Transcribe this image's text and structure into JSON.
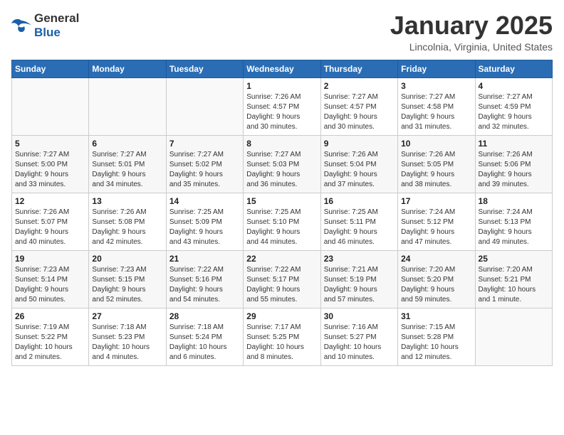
{
  "logo": {
    "general": "General",
    "blue": "Blue"
  },
  "title": "January 2025",
  "subtitle": "Lincolnia, Virginia, United States",
  "days_header": [
    "Sunday",
    "Monday",
    "Tuesday",
    "Wednesday",
    "Thursday",
    "Friday",
    "Saturday"
  ],
  "weeks": [
    [
      {
        "day": "",
        "info": ""
      },
      {
        "day": "",
        "info": ""
      },
      {
        "day": "",
        "info": ""
      },
      {
        "day": "1",
        "info": "Sunrise: 7:26 AM\nSunset: 4:57 PM\nDaylight: 9 hours\nand 30 minutes."
      },
      {
        "day": "2",
        "info": "Sunrise: 7:27 AM\nSunset: 4:57 PM\nDaylight: 9 hours\nand 30 minutes."
      },
      {
        "day": "3",
        "info": "Sunrise: 7:27 AM\nSunset: 4:58 PM\nDaylight: 9 hours\nand 31 minutes."
      },
      {
        "day": "4",
        "info": "Sunrise: 7:27 AM\nSunset: 4:59 PM\nDaylight: 9 hours\nand 32 minutes."
      }
    ],
    [
      {
        "day": "5",
        "info": "Sunrise: 7:27 AM\nSunset: 5:00 PM\nDaylight: 9 hours\nand 33 minutes."
      },
      {
        "day": "6",
        "info": "Sunrise: 7:27 AM\nSunset: 5:01 PM\nDaylight: 9 hours\nand 34 minutes."
      },
      {
        "day": "7",
        "info": "Sunrise: 7:27 AM\nSunset: 5:02 PM\nDaylight: 9 hours\nand 35 minutes."
      },
      {
        "day": "8",
        "info": "Sunrise: 7:27 AM\nSunset: 5:03 PM\nDaylight: 9 hours\nand 36 minutes."
      },
      {
        "day": "9",
        "info": "Sunrise: 7:26 AM\nSunset: 5:04 PM\nDaylight: 9 hours\nand 37 minutes."
      },
      {
        "day": "10",
        "info": "Sunrise: 7:26 AM\nSunset: 5:05 PM\nDaylight: 9 hours\nand 38 minutes."
      },
      {
        "day": "11",
        "info": "Sunrise: 7:26 AM\nSunset: 5:06 PM\nDaylight: 9 hours\nand 39 minutes."
      }
    ],
    [
      {
        "day": "12",
        "info": "Sunrise: 7:26 AM\nSunset: 5:07 PM\nDaylight: 9 hours\nand 40 minutes."
      },
      {
        "day": "13",
        "info": "Sunrise: 7:26 AM\nSunset: 5:08 PM\nDaylight: 9 hours\nand 42 minutes."
      },
      {
        "day": "14",
        "info": "Sunrise: 7:25 AM\nSunset: 5:09 PM\nDaylight: 9 hours\nand 43 minutes."
      },
      {
        "day": "15",
        "info": "Sunrise: 7:25 AM\nSunset: 5:10 PM\nDaylight: 9 hours\nand 44 minutes."
      },
      {
        "day": "16",
        "info": "Sunrise: 7:25 AM\nSunset: 5:11 PM\nDaylight: 9 hours\nand 46 minutes."
      },
      {
        "day": "17",
        "info": "Sunrise: 7:24 AM\nSunset: 5:12 PM\nDaylight: 9 hours\nand 47 minutes."
      },
      {
        "day": "18",
        "info": "Sunrise: 7:24 AM\nSunset: 5:13 PM\nDaylight: 9 hours\nand 49 minutes."
      }
    ],
    [
      {
        "day": "19",
        "info": "Sunrise: 7:23 AM\nSunset: 5:14 PM\nDaylight: 9 hours\nand 50 minutes."
      },
      {
        "day": "20",
        "info": "Sunrise: 7:23 AM\nSunset: 5:15 PM\nDaylight: 9 hours\nand 52 minutes."
      },
      {
        "day": "21",
        "info": "Sunrise: 7:22 AM\nSunset: 5:16 PM\nDaylight: 9 hours\nand 54 minutes."
      },
      {
        "day": "22",
        "info": "Sunrise: 7:22 AM\nSunset: 5:17 PM\nDaylight: 9 hours\nand 55 minutes."
      },
      {
        "day": "23",
        "info": "Sunrise: 7:21 AM\nSunset: 5:19 PM\nDaylight: 9 hours\nand 57 minutes."
      },
      {
        "day": "24",
        "info": "Sunrise: 7:20 AM\nSunset: 5:20 PM\nDaylight: 9 hours\nand 59 minutes."
      },
      {
        "day": "25",
        "info": "Sunrise: 7:20 AM\nSunset: 5:21 PM\nDaylight: 10 hours\nand 1 minute."
      }
    ],
    [
      {
        "day": "26",
        "info": "Sunrise: 7:19 AM\nSunset: 5:22 PM\nDaylight: 10 hours\nand 2 minutes."
      },
      {
        "day": "27",
        "info": "Sunrise: 7:18 AM\nSunset: 5:23 PM\nDaylight: 10 hours\nand 4 minutes."
      },
      {
        "day": "28",
        "info": "Sunrise: 7:18 AM\nSunset: 5:24 PM\nDaylight: 10 hours\nand 6 minutes."
      },
      {
        "day": "29",
        "info": "Sunrise: 7:17 AM\nSunset: 5:25 PM\nDaylight: 10 hours\nand 8 minutes."
      },
      {
        "day": "30",
        "info": "Sunrise: 7:16 AM\nSunset: 5:27 PM\nDaylight: 10 hours\nand 10 minutes."
      },
      {
        "day": "31",
        "info": "Sunrise: 7:15 AM\nSunset: 5:28 PM\nDaylight: 10 hours\nand 12 minutes."
      },
      {
        "day": "",
        "info": ""
      }
    ]
  ]
}
